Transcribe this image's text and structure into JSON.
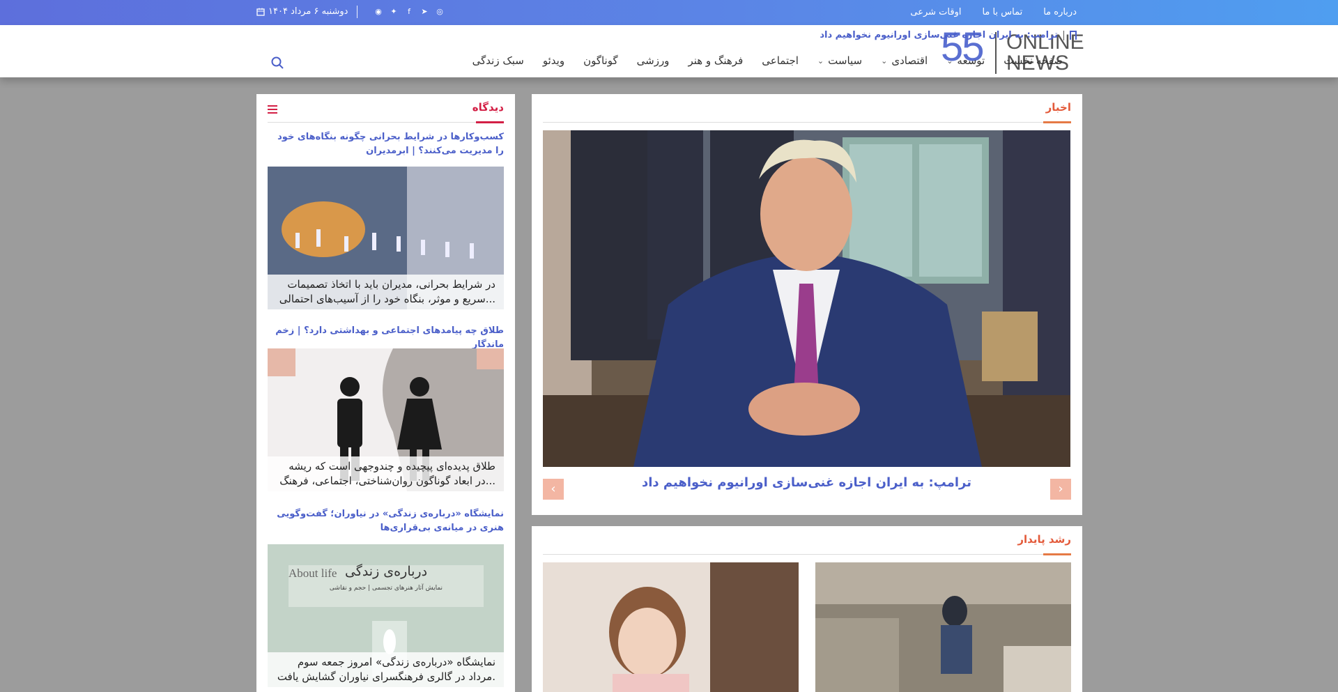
{
  "topbar": {
    "links": [
      "درباره ما",
      "تماس با ما",
      "اوقات شرعی"
    ],
    "date": "دوشنبه ۶ مرداد ۱۴۰۴",
    "social_icons": [
      "instagram-icon",
      "telegram-icon",
      "facebook-icon",
      "twitter-icon",
      "rss-icon"
    ]
  },
  "header": {
    "logo": {
      "number": "55",
      "line1": "ONLINE",
      "line2": "NEWS"
    },
    "ticker": "ترامپ: به ایران اجازه غنی‌سازی اورانیوم نخواهیم داد",
    "nav": [
      {
        "label": "صفحه نخست",
        "dropdown": false
      },
      {
        "label": "توسعه",
        "dropdown": true
      },
      {
        "label": "اقتصادی",
        "dropdown": true
      },
      {
        "label": "سیاست",
        "dropdown": true
      },
      {
        "label": "اجتماعی",
        "dropdown": false
      },
      {
        "label": "فرهنگ و هنر",
        "dropdown": false
      },
      {
        "label": "ورزشی",
        "dropdown": false
      },
      {
        "label": "گوناگون",
        "dropdown": false
      },
      {
        "label": "ویدئو",
        "dropdown": false
      },
      {
        "label": "سبک زندگی",
        "dropdown": false
      }
    ]
  },
  "news": {
    "section_title": "اخبار",
    "headline": "ترامپ: به ایران اجازه غنی‌سازی اورانیوم نخواهیم داد",
    "watermark_number": "55",
    "watermark_text": "ONLINE NEWS"
  },
  "sustainable": {
    "section_title": "رشد پایدار"
  },
  "opinion": {
    "section_title": "دیدگاه",
    "items": [
      {
        "title": "کسب‌وکارها در شرایط بحرانی چگونه بنگاه‌های خود را مدیریت می‌کنند؟ | ابرمدیران",
        "excerpt": "در شرایط بحرانی، مدیران باید با اتخاذ تصمیمات سریع و موثر، بنگاه خود را از آسیب‌های احتمالی..."
      },
      {
        "title": "طلاق چه پیامدهای اجتماعی و بهداشتی دارد؟ | زخم ماندگار",
        "excerpt": "طلاق پدیده‌ای پیچیده و چندوجهی است که ریشه در ابعاد گوناگون روان‌شناختی، اجتماعی، فرهنگ..."
      },
      {
        "title": "نمایشگاه «درباره‌ی زندگی» در نیاوران؛ گفت‌وگویی هنری در میانه‌ی بی‌قراری‌ها",
        "excerpt": "نمایشگاه «درباره‌ی زندگی» امروز جمعه سوم مرداد در گالری فرهنگسرای نیاوران گشایش یافت.",
        "poster_title": "درباره‌ی زندگی",
        "poster_en": "About life",
        "poster_sub": "نمایش آثار هنرهای تجسمی | حجم و نقاشی"
      }
    ]
  },
  "colors": {
    "accent": "#4b5fc9",
    "orange": "#e35a3a",
    "red": "#d31f45"
  }
}
